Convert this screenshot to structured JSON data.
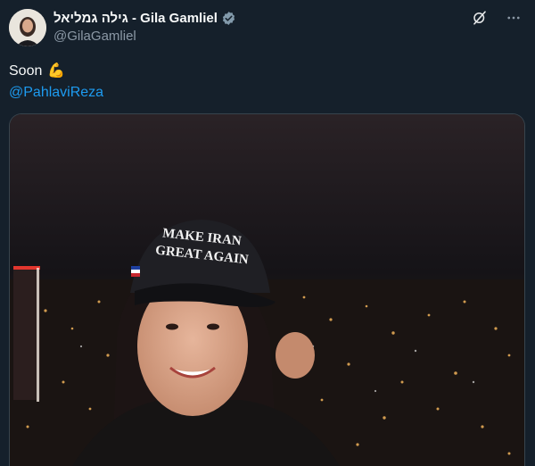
{
  "author": {
    "display_name": "גילה גמליאל - Gila Gamliel",
    "handle": "@GilaGamliel",
    "verified_icon": "verified-badge-icon"
  },
  "top_actions": {
    "grok_icon": "grok-icon",
    "more_icon": "more-options-icon"
  },
  "tweet": {
    "text_line1": "Soon",
    "emoji": "💪",
    "mention": "@PahlaviReza"
  },
  "media": {
    "cap_text_line1": "MAKE IRAN",
    "cap_text_line2": "GREAT AGAIN"
  },
  "colors": {
    "background": "#15202b",
    "link": "#1d9bf0",
    "secondary_text": "#8b98a5",
    "verified": "#829aab"
  }
}
